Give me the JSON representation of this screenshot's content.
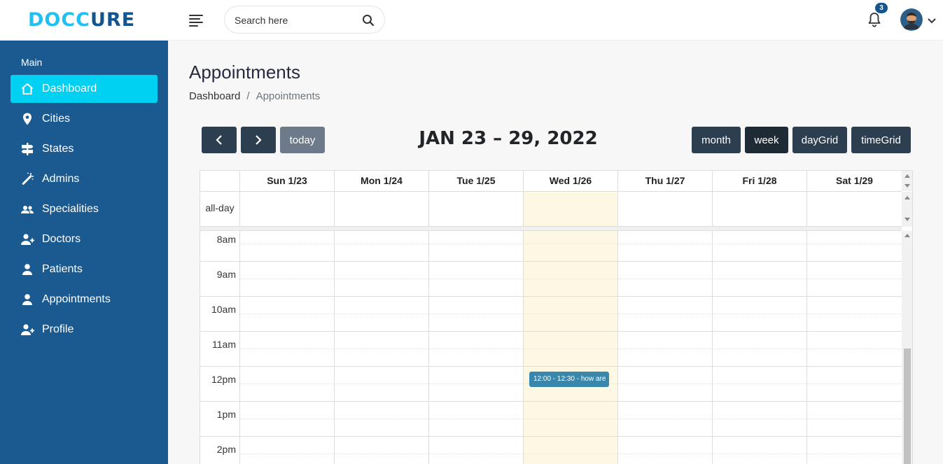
{
  "brand": {
    "logo_text_a": "DOCC",
    "logo_text_b": "URE",
    "primary_color": "#20c0f3",
    "secondary_color": "#15558d"
  },
  "header": {
    "search_placeholder": "Search here",
    "notification_count": "3"
  },
  "sidebar": {
    "section_title": "Main",
    "items": [
      {
        "label": "Dashboard",
        "icon": "home-icon",
        "active": true
      },
      {
        "label": "Cities",
        "icon": "map-pin-icon"
      },
      {
        "label": "States",
        "icon": "signpost-icon"
      },
      {
        "label": "Admins",
        "icon": "magic-wand-icon"
      },
      {
        "label": "Specialities",
        "icon": "users-icon"
      },
      {
        "label": "Doctors",
        "icon": "user-plus-icon"
      },
      {
        "label": "Patients",
        "icon": "user-icon"
      },
      {
        "label": "Appointments",
        "icon": "user-icon"
      },
      {
        "label": "Profile",
        "icon": "user-plus-icon"
      }
    ],
    "background": "#1b5a90",
    "active_color": "#00d0f1"
  },
  "page": {
    "title": "Appointments",
    "breadcrumb": {
      "home": "Dashboard",
      "separator": "/",
      "current": "Appointments"
    }
  },
  "calendar": {
    "title": "JAN 23 – 29, 2022",
    "today_button": "today",
    "views": [
      "month",
      "week",
      "dayGrid",
      "timeGrid"
    ],
    "active_view": "week",
    "allday_label": "all-day",
    "days": [
      "Sun 1/23",
      "Mon 1/24",
      "Tue 1/25",
      "Wed 1/26",
      "Thu 1/27",
      "Fri 1/28",
      "Sat 1/29"
    ],
    "today_index": 3,
    "hours": [
      "8am",
      "9am",
      "10am",
      "11am",
      "12pm",
      "1pm",
      "2pm"
    ],
    "event": {
      "text": "12:00 - 12:30 - how are",
      "day": "Wed 1/26",
      "color": "#3a87ad"
    },
    "today_highlight": "#fcf8e3"
  }
}
